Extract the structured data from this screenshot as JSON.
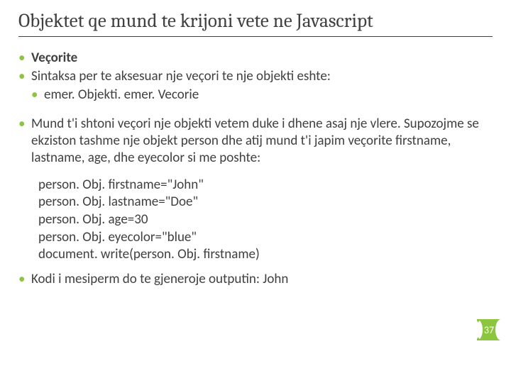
{
  "title": "Objektet qe mund te krijoni vete ne Javascript",
  "bullets": {
    "b1": "Veçorite",
    "b2": "Sintaksa per te aksesuar nje veçori te nje objekti eshte:",
    "b2_1": "emer. Objekti. emer. Vecorie",
    "b3": "Mund t'i shtoni veçori nje objekti vetem duke i dhene asaj nje vlere. Supozojme se ekziston tashme nje objekt person dhe atij mund t'i japim veçorite firstname, lastname, age, dhe eyecolor si me poshte:",
    "b4": "Kodi i mesiperm do te gjeneroje outputin: John"
  },
  "code": {
    "l1": "person. Obj. firstname=\"John\"",
    "l2": "person. Obj. lastname=\"Doe\"",
    "l3": "person. Obj. age=30",
    "l4": "person. Obj. eyecolor=\"blue\"",
    "l5": "document. write(person. Obj. firstname)"
  },
  "page_number": "37"
}
